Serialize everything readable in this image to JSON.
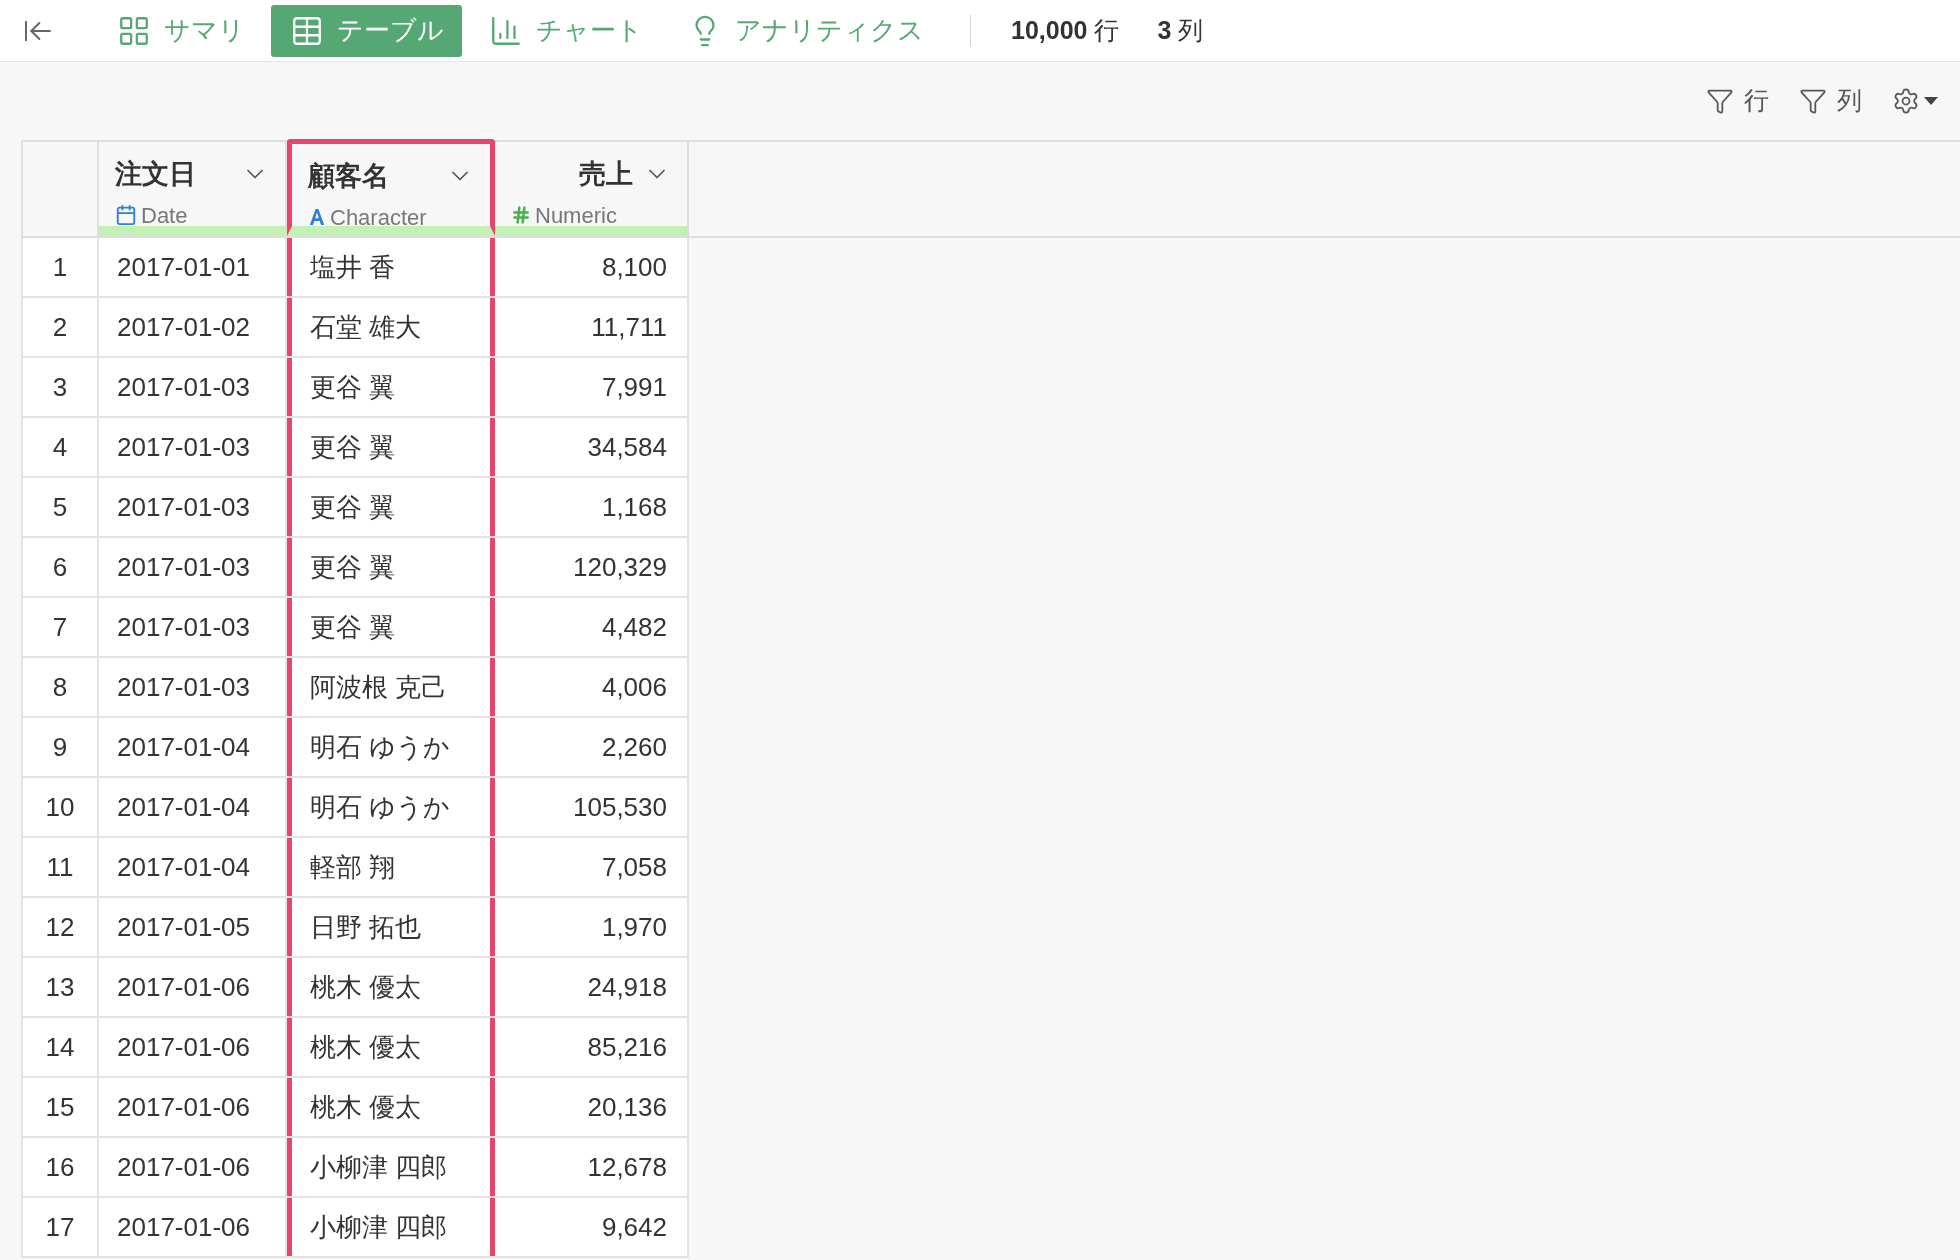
{
  "tabs": [
    {
      "label": "サマリ",
      "selected": false
    },
    {
      "label": "テーブル",
      "selected": true
    },
    {
      "label": "チャート",
      "selected": false
    },
    {
      "label": "アナリティクス",
      "selected": false
    }
  ],
  "counts": [
    {
      "value": "10,000",
      "unit": "行"
    },
    {
      "value": "3",
      "unit": "列"
    }
  ],
  "toolbar": {
    "row_filter": "行",
    "column_filter": "列"
  },
  "table": {
    "columns": [
      {
        "name": "注文日",
        "type": "Date",
        "kind": "date",
        "highlighted": false
      },
      {
        "name": "顧客名",
        "type": "Character",
        "kind": "character",
        "highlighted": true
      },
      {
        "name": "売上",
        "type": "Numeric",
        "kind": "numeric",
        "highlighted": false
      }
    ],
    "rows": [
      {
        "number": "1",
        "cells": [
          "2017-01-01",
          "塩井 香",
          "8,100"
        ]
      },
      {
        "number": "2",
        "cells": [
          "2017-01-02",
          "石堂 雄大",
          "11,711"
        ]
      },
      {
        "number": "3",
        "cells": [
          "2017-01-03",
          "更谷 翼",
          "7,991"
        ]
      },
      {
        "number": "4",
        "cells": [
          "2017-01-03",
          "更谷 翼",
          "34,584"
        ]
      },
      {
        "number": "5",
        "cells": [
          "2017-01-03",
          "更谷 翼",
          "1,168"
        ]
      },
      {
        "number": "6",
        "cells": [
          "2017-01-03",
          "更谷 翼",
          "120,329"
        ]
      },
      {
        "number": "7",
        "cells": [
          "2017-01-03",
          "更谷 翼",
          "4,482"
        ]
      },
      {
        "number": "8",
        "cells": [
          "2017-01-03",
          "阿波根 克己",
          "4,006"
        ]
      },
      {
        "number": "9",
        "cells": [
          "2017-01-04",
          "明石 ゆうか",
          "2,260"
        ]
      },
      {
        "number": "10",
        "cells": [
          "2017-01-04",
          "明石 ゆうか",
          "105,530"
        ]
      },
      {
        "number": "11",
        "cells": [
          "2017-01-04",
          "軽部 翔",
          "7,058"
        ]
      },
      {
        "number": "12",
        "cells": [
          "2017-01-05",
          "日野 拓也",
          "1,970"
        ]
      },
      {
        "number": "13",
        "cells": [
          "2017-01-06",
          "桃木 優太",
          "24,918"
        ]
      },
      {
        "number": "14",
        "cells": [
          "2017-01-06",
          "桃木 優太",
          "85,216"
        ]
      },
      {
        "number": "15",
        "cells": [
          "2017-01-06",
          "桃木 優太",
          "20,136"
        ]
      },
      {
        "number": "16",
        "cells": [
          "2017-01-06",
          "小柳津 四郎",
          "12,678"
        ]
      },
      {
        "number": "17",
        "cells": [
          "2017-01-06",
          "小柳津 四郎",
          "9,642"
        ]
      }
    ]
  }
}
